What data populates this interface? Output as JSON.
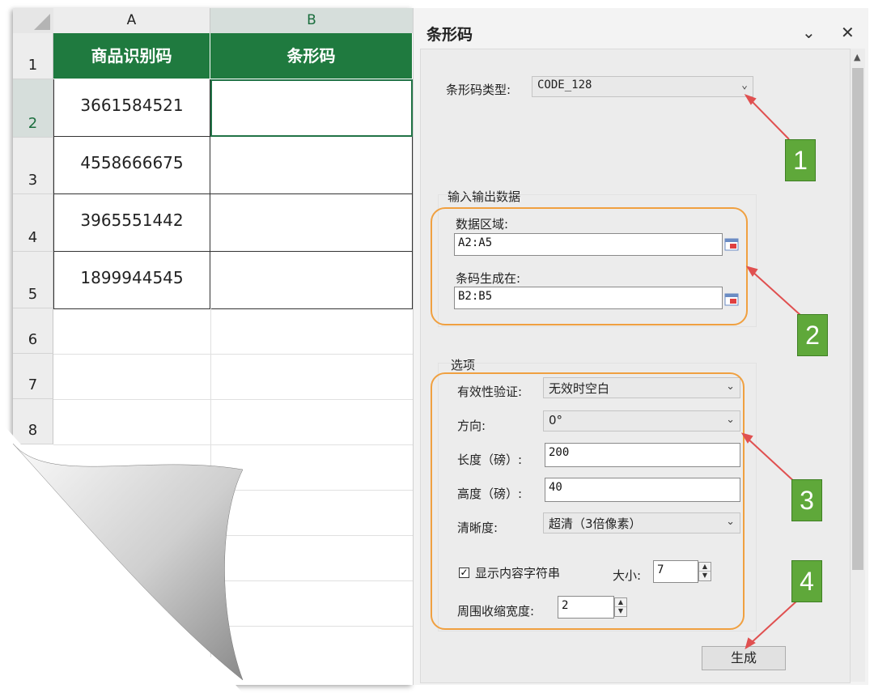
{
  "spreadsheet": {
    "columns": [
      "A",
      "B"
    ],
    "rows": [
      "1",
      "2",
      "3",
      "4",
      "5",
      "6",
      "7",
      "8"
    ],
    "headers": [
      "商品识别码",
      "条形码"
    ],
    "values": [
      "3661584521",
      "4558666675",
      "3965551442",
      "1899944545"
    ]
  },
  "dialog": {
    "title": "条形码",
    "barcode_type_label": "条形码类型:",
    "barcode_type_value": "CODE_128",
    "io_group_title": "输入输出数据",
    "data_range_label": "数据区域:",
    "data_range_value": "A2:A5",
    "output_label": "条码生成在:",
    "output_value": "B2:B5",
    "options_group_title": "选项",
    "validation_label": "有效性验证:",
    "validation_value": "无效时空白",
    "direction_label": "方向:",
    "direction_value": "0°",
    "length_label": "长度（磅）:",
    "length_value": "200",
    "height_label": "高度（磅）:",
    "height_value": "40",
    "clarity_label": "清晰度:",
    "clarity_value": "超清（3倍像素）",
    "show_text_label": "显示内容字符串",
    "show_text_checked": true,
    "size_label": "大小:",
    "size_value": "7",
    "margin_label": "周围收缩宽度:",
    "margin_value": "2",
    "generate_button": "生成"
  },
  "annotations": {
    "badges": [
      "1",
      "2",
      "3",
      "4"
    ],
    "highlight_color": "#f0a040",
    "badge_color": "#5fa83a",
    "arrow_color": "#e05050"
  },
  "colors": {
    "header_green": "#1f7a3f"
  }
}
